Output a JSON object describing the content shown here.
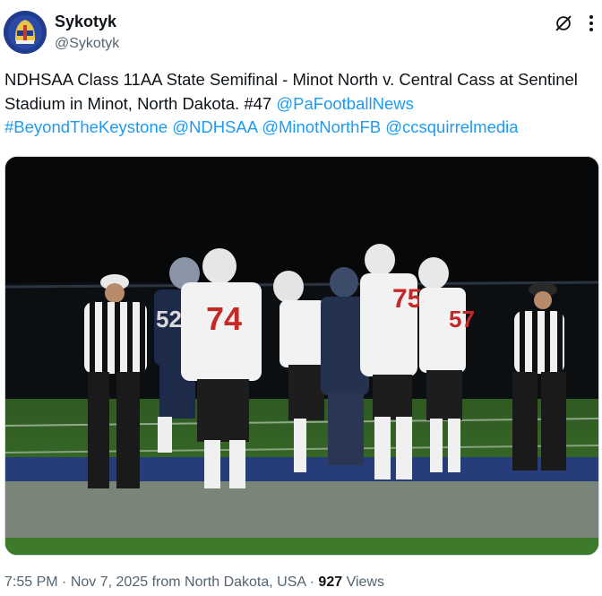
{
  "author": {
    "display_name": "Sykotyk",
    "handle": "@Sykotyk",
    "avatar_icon": "avatar-image"
  },
  "header_actions": {
    "grok_icon": "grok-icon",
    "more_icon": "more-dots-icon"
  },
  "tweet": {
    "text_plain": "NDHSAA Class 11AA State Semifinal - Minot North v. Central Cass at Sentinel Stadium in Minot, North Dakota. #47 ",
    "mentions": [
      "@PaFootballNews",
      "#BeyondTheKeystone",
      "@NDHSAA",
      "@MinotNorthFB",
      "@ccsquirrelmedia"
    ]
  },
  "media": {
    "jersey_numbers": [
      "52",
      "74",
      "75",
      "57"
    ]
  },
  "meta": {
    "time": "7:55 PM",
    "separator": "·",
    "date": "Nov 7, 2025",
    "location": "from North Dakota, USA",
    "views_count": "927",
    "views_label": "Views"
  },
  "colors": {
    "link": "#1d9bf0",
    "secondary_text": "#536471",
    "primary_text": "#0f1419"
  }
}
